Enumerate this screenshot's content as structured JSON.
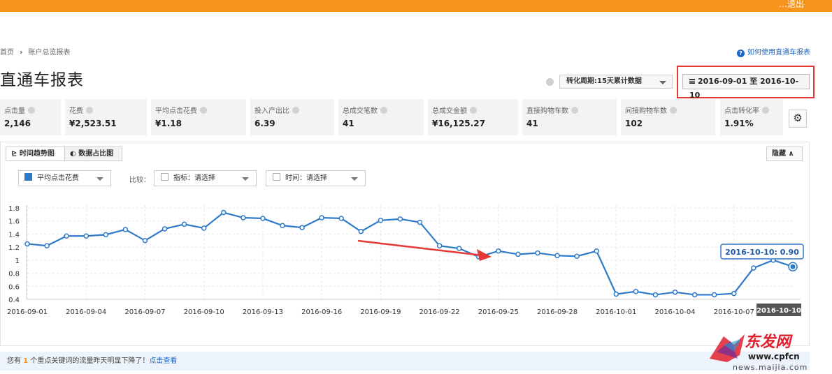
{
  "header": {
    "user_text": "…退出"
  },
  "breadcrumb": {
    "home": "首页",
    "current": "账户总览报表"
  },
  "help_link": "如何使用直通车报表",
  "page_title": "直通车报表",
  "period_select": "转化周期:15天累计数据",
  "date_range": "2016-09-01 至 2016-10-10",
  "metrics": [
    {
      "label": "点击量",
      "value": "2,146"
    },
    {
      "label": "花费",
      "value": "¥2,523.51"
    },
    {
      "label": "平均点击花费",
      "value": "¥1.18"
    },
    {
      "label": "投入产出比",
      "value": "6.39"
    },
    {
      "label": "总成交笔数",
      "value": "41"
    },
    {
      "label": "总成交金额",
      "value": "¥16,125.27"
    },
    {
      "label": "直接购物车数",
      "value": "41"
    },
    {
      "label": "间接购物车数",
      "value": "102"
    },
    {
      "label": "点击转化率",
      "value": "1.91%"
    }
  ],
  "settings_icon": "gear-icon",
  "tabs": {
    "trend": "时间趋势图",
    "share": "数据占比图"
  },
  "hide_button": "隐藏 ∧",
  "metric_select": "平均点击花费",
  "compare_label": "比较：",
  "indicator_select": "指标：请选择",
  "time_select": "时间：请选择",
  "chart_data": {
    "type": "line",
    "series": [
      {
        "name": "平均点击花费",
        "x": [
          "2016-09-01",
          "2016-09-02",
          "2016-09-03",
          "2016-09-04",
          "2016-09-05",
          "2016-09-06",
          "2016-09-07",
          "2016-09-08",
          "2016-09-09",
          "2016-09-10",
          "2016-09-11",
          "2016-09-12",
          "2016-09-13",
          "2016-09-14",
          "2016-09-15",
          "2016-09-16",
          "2016-09-17",
          "2016-09-18",
          "2016-09-19",
          "2016-09-20",
          "2016-09-21",
          "2016-09-22",
          "2016-09-23",
          "2016-09-24",
          "2016-09-25",
          "2016-09-26",
          "2016-09-27",
          "2016-09-28",
          "2016-09-29",
          "2016-09-30",
          "2016-10-01",
          "2016-10-02",
          "2016-10-03",
          "2016-10-04",
          "2016-10-05",
          "2016-10-06",
          "2016-10-07",
          "2016-10-08",
          "2016-10-09",
          "2016-10-10"
        ],
        "values": [
          1.25,
          1.22,
          1.37,
          1.37,
          1.39,
          1.47,
          1.3,
          1.48,
          1.55,
          1.49,
          1.73,
          1.65,
          1.64,
          1.53,
          1.5,
          1.65,
          1.64,
          1.44,
          1.61,
          1.63,
          1.58,
          1.22,
          1.18,
          1.05,
          1.14,
          1.09,
          1.11,
          1.07,
          1.06,
          1.14,
          0.48,
          0.52,
          0.47,
          0.51,
          0.47,
          0.47,
          0.49,
          0.88,
          1.0,
          0.9
        ]
      }
    ],
    "x_ticks": [
      "2016-09-01",
      "2016-09-04",
      "2016-09-07",
      "2016-09-10",
      "2016-09-13",
      "2016-09-16",
      "2016-09-19",
      "2016-09-22",
      "2016-09-25",
      "2016-09-28",
      "2016-10-01",
      "2016-10-04",
      "2016-10-07"
    ],
    "y_ticks": [
      "0.4",
      "0.6",
      "0.8",
      "1",
      "1.2",
      "1.4",
      "1.6",
      "1.8"
    ],
    "ylim": [
      0.4,
      1.8
    ],
    "grid": true,
    "tooltip": "2016-10-10: 0.90",
    "crosshair_label": "2016-10-10",
    "line_color": "#2e79c9",
    "arrow_color": "#e53935"
  },
  "notice": {
    "prefix": "您有",
    "count": "1",
    "suffix": "个重点关键词的流量昨天明显下降了！",
    "link": "点击查看"
  },
  "watermark": {
    "cn": "东发网",
    "url1": "www.cpfcn",
    "url2": "news.maijia.com"
  }
}
